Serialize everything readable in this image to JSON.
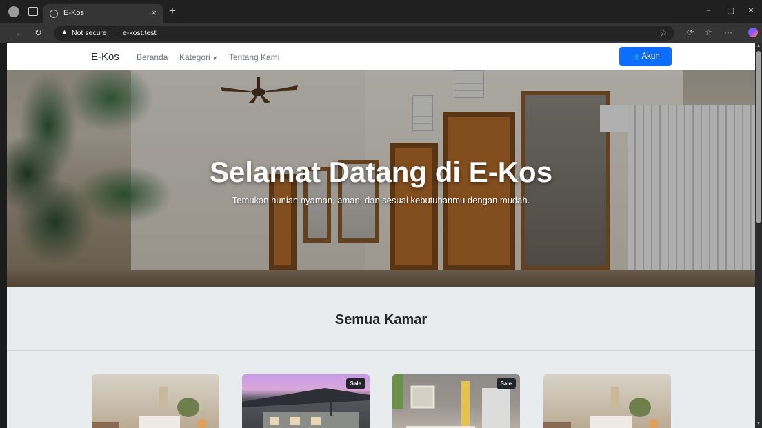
{
  "browser": {
    "tab_title": "E-Kos",
    "tab_close": "×",
    "new_tab": "+",
    "security_label": "Not secure",
    "url": "e-kost.test",
    "window_controls": [
      "−",
      "▢",
      "✕"
    ],
    "icons": [
      "profile-icon",
      "tabs-icon",
      "back-icon",
      "refresh-icon",
      "warning-icon",
      "star-icon",
      "extensions-icon",
      "favorites-icon",
      "more-icon",
      "copilot-icon"
    ]
  },
  "navbar": {
    "brand": "E-Kos",
    "links": [
      "Beranda",
      "Kategori",
      "Tentang Kami"
    ],
    "account_button": "Akun"
  },
  "hero": {
    "title": "Selamat Datang di E-Kos",
    "subtitle": "Temukan hunian nyaman, aman, dan sesuai kebutuhanmu dengan mudah."
  },
  "section": {
    "title": "Semua Kamar"
  },
  "rooms": [
    {
      "badge": ""
    },
    {
      "badge": "Sale"
    },
    {
      "badge": "Sale"
    },
    {
      "badge": ""
    }
  ],
  "colors": {
    "primary": "#0d6efd",
    "page_bg": "#e9ecef",
    "badge_bg": "#212529"
  }
}
